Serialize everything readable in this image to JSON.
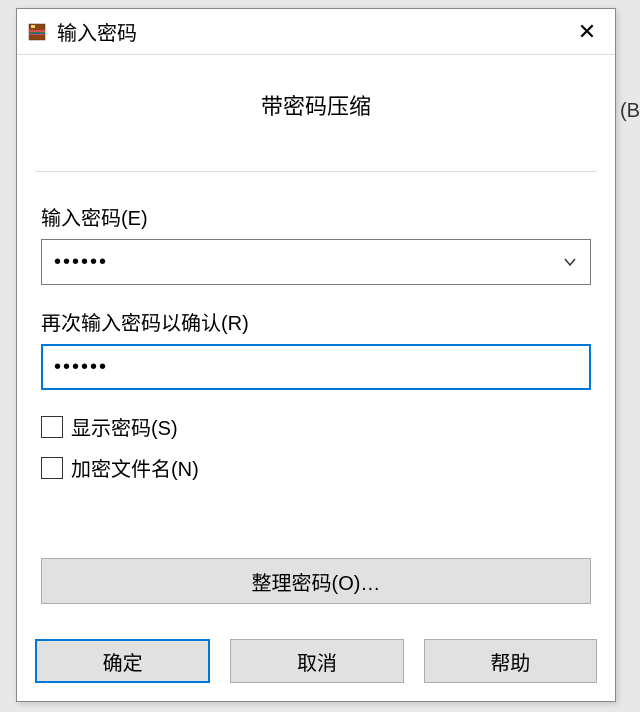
{
  "dialog": {
    "title": "输入密码",
    "group_title": "带密码压缩",
    "password_label": "输入密码(E)",
    "password_value": "••••••",
    "confirm_label": "再次输入密码以确认(R)",
    "confirm_value": "••••••",
    "show_password_label": "显示密码(S)",
    "encrypt_filenames_label": "加密文件名(N)",
    "organize_label": "整理密码(O)…",
    "ok_label": "确定",
    "cancel_label": "取消",
    "help_label": "帮助"
  },
  "bg": {
    "b": "(B"
  }
}
